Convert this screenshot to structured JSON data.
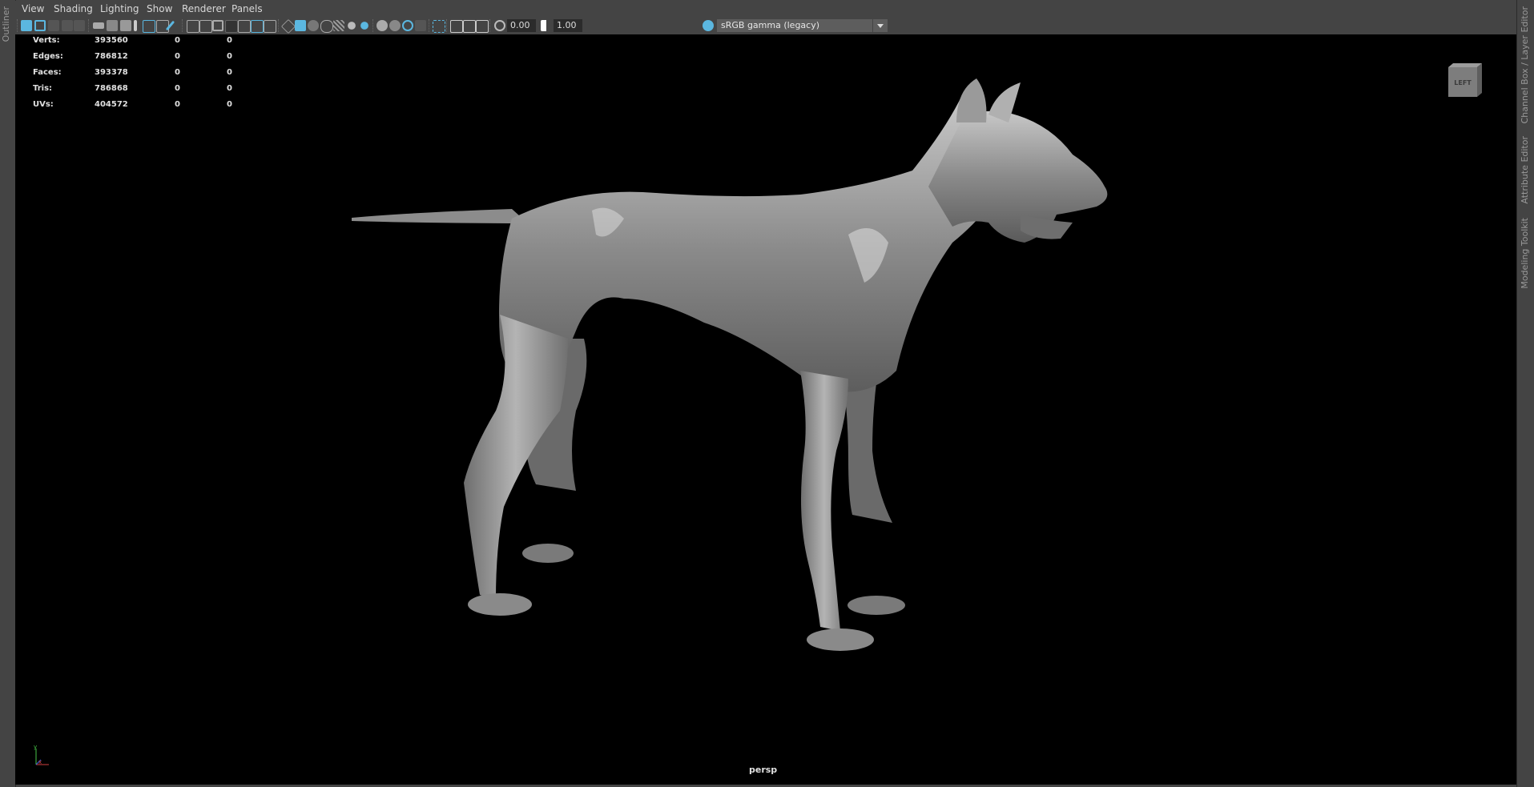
{
  "left_panel": {
    "label": "Outliner"
  },
  "right_panel": {
    "tabs": [
      "Channel Box / Layer Editor",
      "Attribute Editor",
      "Modeling Toolkit"
    ]
  },
  "menu": {
    "items": [
      "View",
      "Shading",
      "Lighting",
      "Show",
      "Renderer",
      "Panels"
    ]
  },
  "toolbar": {
    "exposure": "0.00",
    "gamma": "1.00",
    "color_space": "sRGB gamma (legacy)",
    "accent": "#5bb7e0"
  },
  "hud": {
    "rows": [
      {
        "label": "Verts:",
        "total": "393560",
        "selected": "0",
        "components": "0"
      },
      {
        "label": "Edges:",
        "total": "786812",
        "selected": "0",
        "components": "0"
      },
      {
        "label": "Faces:",
        "total": "393378",
        "selected": "0",
        "components": "0"
      },
      {
        "label": "Tris:",
        "total": "786868",
        "selected": "0",
        "components": "0"
      },
      {
        "label": "UVs:",
        "total": "404572",
        "selected": "0",
        "components": "0"
      }
    ]
  },
  "viewcube": {
    "face": "LEFT"
  },
  "camera": {
    "name": "persp"
  },
  "axis": {
    "y": "y",
    "x": "x"
  }
}
